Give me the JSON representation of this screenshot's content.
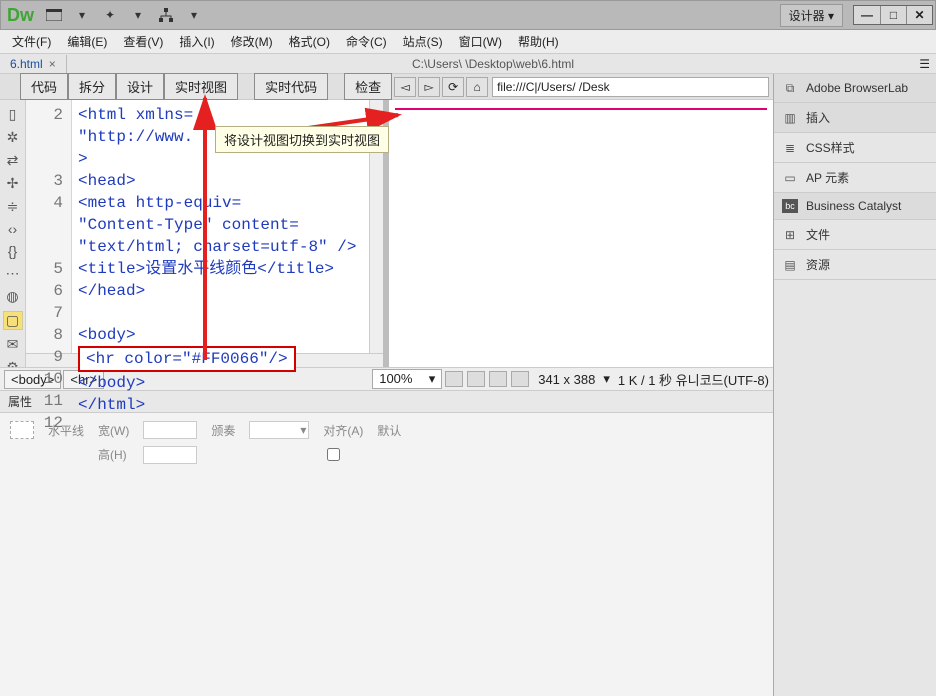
{
  "title": {
    "designer": "设计器",
    "dw": "Dw"
  },
  "menu": [
    "文件(F)",
    "编辑(E)",
    "查看(V)",
    "插入(I)",
    "修改(M)",
    "格式(O)",
    "命令(C)",
    "站点(S)",
    "窗口(W)",
    "帮助(H)"
  ],
  "tabs": {
    "active": "6.html",
    "path": "C:\\Users\\    \\Desktop\\web\\6.html"
  },
  "viewbar": {
    "buttons": [
      "代码",
      "拆分",
      "设计",
      "实时视图"
    ],
    "buttons2": [
      "实时代码",
      "检查"
    ],
    "address": "file:///C|/Users/        /Desk"
  },
  "tooltip": "将设计视图切换到实时视图",
  "code": {
    "lines": [
      "2",
      "3",
      "4",
      "5",
      "6",
      "7",
      "8",
      "9",
      "10",
      "11",
      "12"
    ],
    "l2a": "<html xmlns=",
    "l2b": "\"http://www.",
    "l2c": ">",
    "l3": "<head>",
    "l4a": "<meta http-equiv=",
    "l4b": "\"Content-Type\" content=",
    "l4c": "\"text/html; charset=utf-8\" />",
    "l5": "<title>设置水平线颜色</title>",
    "l6": "</head>",
    "l7": "",
    "l8": "<body>",
    "l9": "<hr color=\"#FF0066\"/>",
    "l10": "</body>",
    "l11": "</html>",
    "l12": ""
  },
  "status": {
    "tags": [
      "<body>",
      "<hr>"
    ],
    "zoom": "100%",
    "dims": "341 x 388",
    "info": "1 K / 1 秒 유니코드(UTF-8)"
  },
  "props": {
    "title": "属性",
    "row": "水平线",
    "wlabel": "宽(W)",
    "hlabel": "高(H)",
    "cls": "颁奏",
    "align": "对齐(A)",
    "alignval": "默认"
  },
  "right": {
    "items": [
      {
        "icon": "browserlab",
        "label": "Adobe BrowserLab"
      },
      {
        "icon": "insert",
        "label": "插入"
      },
      {
        "icon": "css",
        "label": "CSS样式"
      },
      {
        "icon": "ap",
        "label": "AP 元素"
      },
      {
        "icon": "bc",
        "label": "Business Catalyst"
      },
      {
        "icon": "files",
        "label": "文件"
      },
      {
        "icon": "assets",
        "label": "资源"
      }
    ]
  }
}
